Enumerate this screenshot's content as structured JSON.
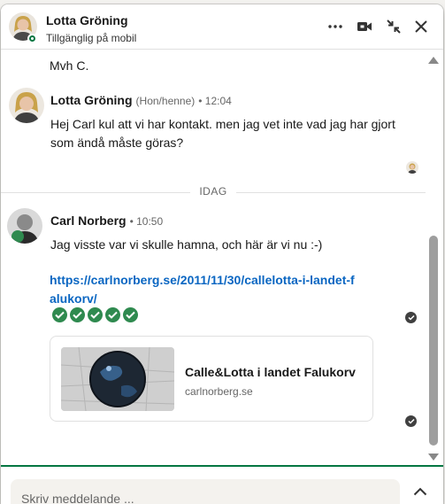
{
  "header": {
    "name": "Lotta Gröning",
    "status": "Tillgänglig på mobil",
    "more_icon": "more-horizontal-icon",
    "video_icon": "video-call-icon",
    "minimize_icon": "minimize-arrows-icon",
    "close_icon": "close-icon"
  },
  "messages": {
    "signoff": "Mvh C.",
    "lotta": {
      "name": "Lotta Gröning",
      "pronouns": "(Hon/henne)",
      "time": "• 12:04",
      "text": "Hej Carl kul att vi har kontakt. men jag vet inte vad jag har gjort som ändå måste göras?"
    },
    "divider": "IDAG",
    "carl": {
      "name": "Carl Norberg",
      "time": "• 10:50",
      "text": "Jag visste var vi skulle hamna, och här är vi nu :-)",
      "link": "https://carlnorberg.se/2011/11/30/callelotta-i-landet-falukorv/",
      "reactions": [
        "check",
        "check",
        "check",
        "check",
        "check"
      ]
    },
    "card": {
      "title": "Calle&Lotta i landet Falukorv",
      "domain": "carlnorberg.se"
    }
  },
  "composer": {
    "placeholder": "Skriv meddelande ...",
    "expand_icon": "chevron-up-icon"
  },
  "colors": {
    "accent_green": "#057642",
    "link_blue": "#0a66c2",
    "reaction_green": "#2f8a4f"
  }
}
